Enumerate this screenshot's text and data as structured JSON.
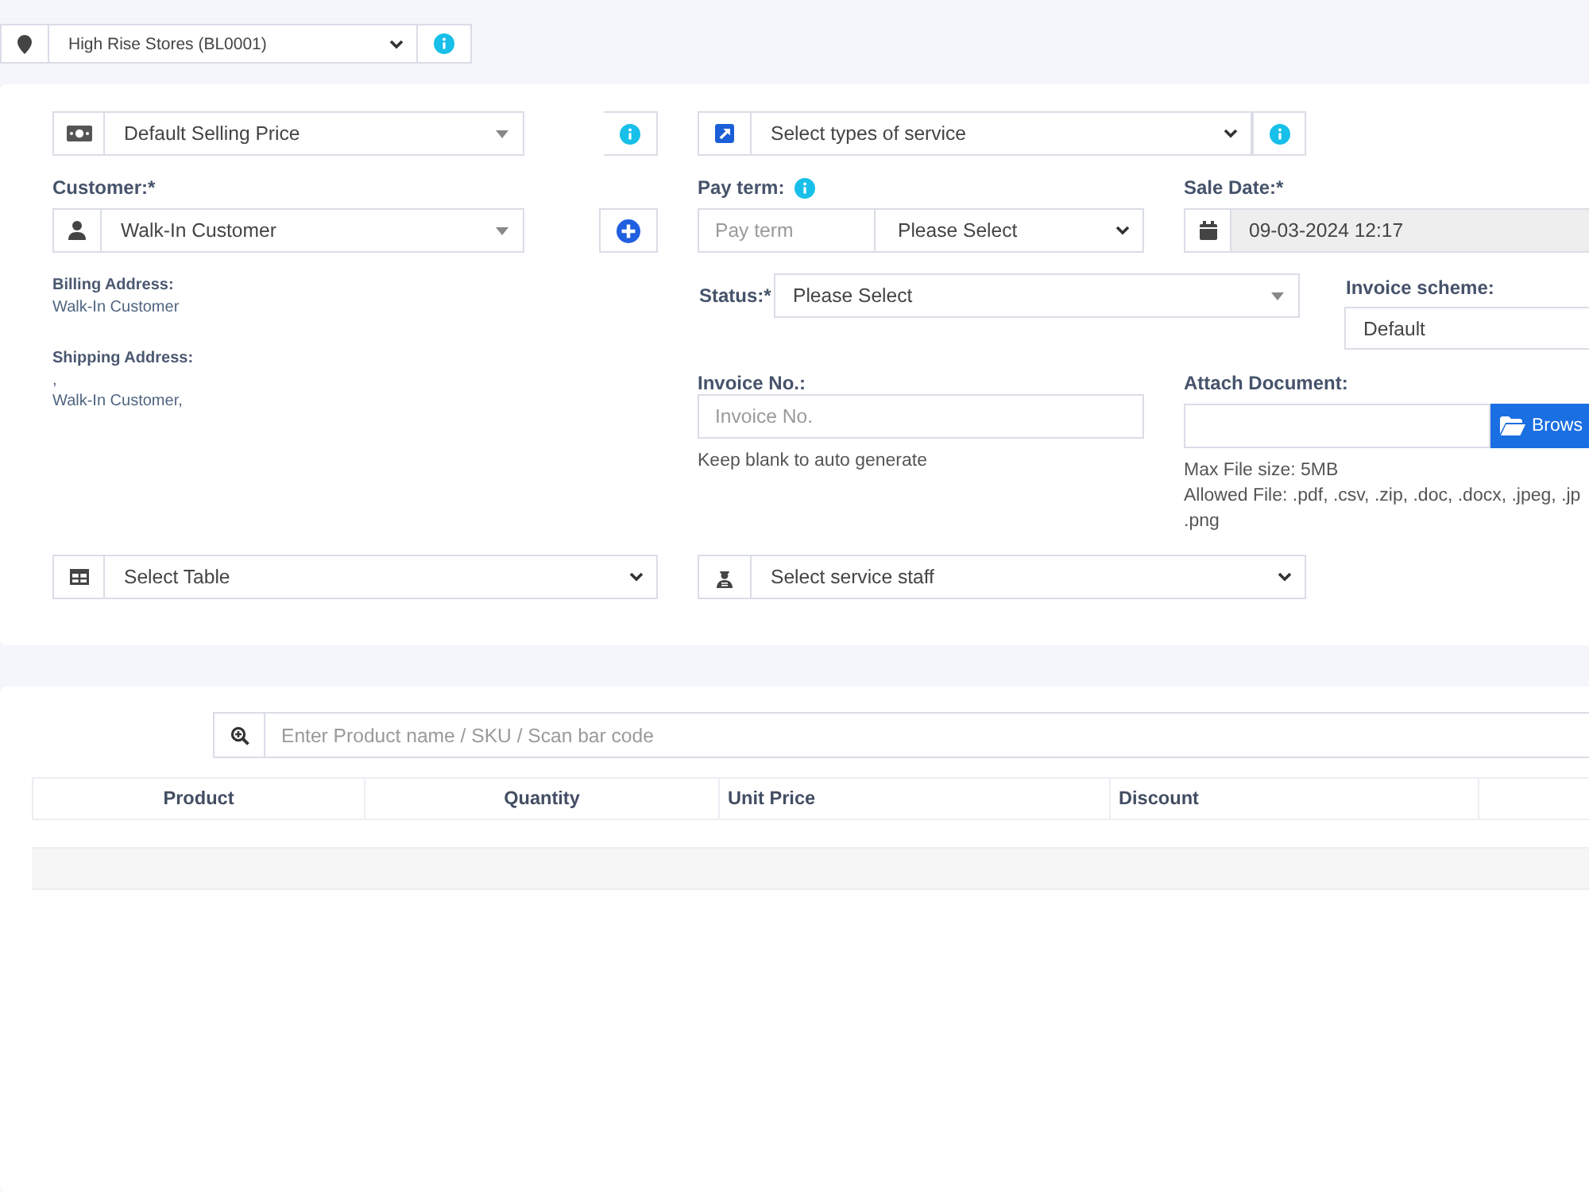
{
  "location": {
    "value": "High Rise Stores (BL0001)"
  },
  "sale_form": {
    "price_group": {
      "value": "Default Selling Price"
    },
    "service_type": {
      "value": "Select types of service"
    },
    "customer": {
      "label": "Customer:*",
      "value": "Walk-In Customer"
    },
    "billing_address": {
      "label": "Billing Address:",
      "lines": [
        "Walk-In Customer"
      ]
    },
    "shipping_address": {
      "label": "Shipping Address:",
      "lines": [
        ",",
        "Walk-In Customer,"
      ]
    },
    "pay_term": {
      "label": "Pay term:",
      "placeholder": "Pay term",
      "period": "Please Select"
    },
    "sale_date": {
      "label": "Sale Date:*",
      "value": "09-03-2024 12:17"
    },
    "status": {
      "label": "Status:*",
      "value": "Please Select"
    },
    "invoice_scheme": {
      "label": "Invoice scheme:",
      "value": "Default"
    },
    "invoice_no": {
      "label": "Invoice No.:",
      "placeholder": "Invoice No.",
      "help": "Keep blank to auto generate"
    },
    "attach_document": {
      "label": "Attach Document:",
      "button": "Brows",
      "max_size": "Max File size: 5MB",
      "allowed_files": [
        "Allowed File: .pdf, .csv, .zip, .doc, .docx, .jpeg, .jp",
        ".png"
      ]
    },
    "table": {
      "value": "Select Table"
    },
    "service_staff": {
      "value": "Select service staff"
    }
  },
  "products": {
    "search": {
      "placeholder": "Enter Product name / SKU / Scan bar code"
    },
    "columns": [
      "Product",
      "Quantity",
      "Unit Price",
      "Discount"
    ]
  }
}
